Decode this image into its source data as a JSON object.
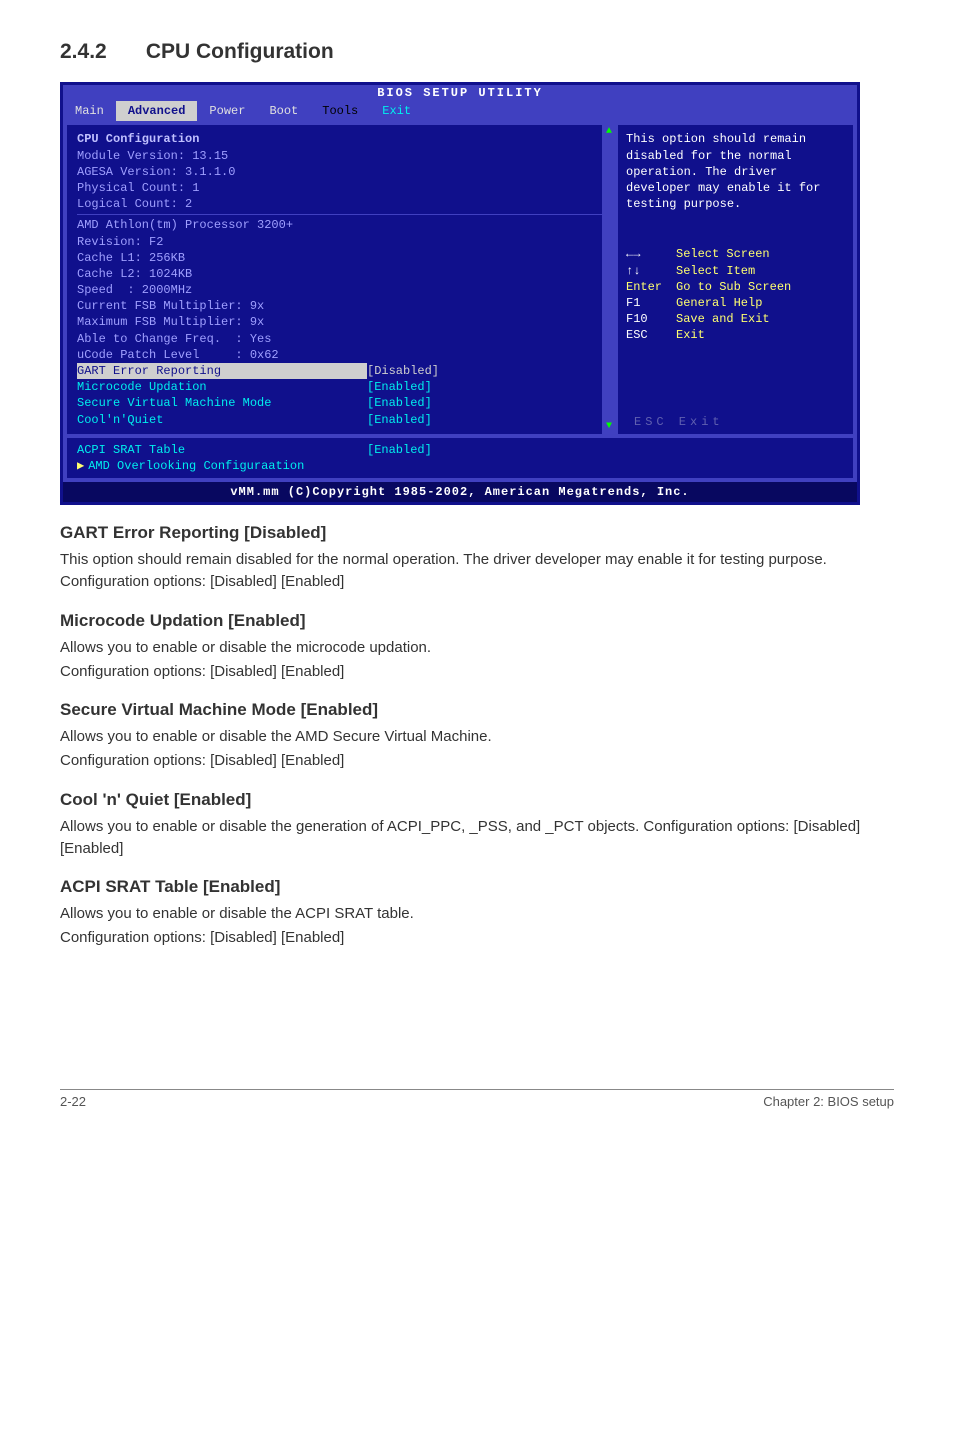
{
  "heading": {
    "number": "2.4.2",
    "title": "CPU Configuration"
  },
  "bios": {
    "util_title": "BIOS SETUP UTILITY",
    "tabs": {
      "main": "Main",
      "advanced": "Advanced",
      "power": "Power",
      "boot": "Boot",
      "tools": "Tools",
      "exit": "Exit"
    },
    "left": {
      "header": "CPU Configuration",
      "info": [
        "Module Version: 13.15",
        "AGESA Version: 3.1.1.0",
        "Physical Count: 1",
        "Logical Count: 2",
        "",
        "AMD Athlon(tm) Processor 3200+",
        "Revision: F2",
        "Cache L1: 256KB",
        "Cache L2: 1024KB",
        "Speed  : 2000MHz",
        "Current FSB Multiplier: 9x",
        "Maximum FSB Multiplier: 9x",
        "Able to Change Freq.  : Yes",
        "uCode Patch Level     : 0x62"
      ],
      "fields": {
        "gart": {
          "label": "GART Error Reporting",
          "value": "[Disabled]"
        },
        "micro": {
          "label": "Microcode Updation",
          "value": "[Enabled]"
        },
        "svm": {
          "label": "Secure Virtual Machine Mode",
          "value": "[Enabled]"
        },
        "cool": {
          "label": "Cool'n'Quiet",
          "value": "[Enabled]"
        }
      }
    },
    "right": {
      "help": "This option should remain disabled for the normal operation. The driver developer may enable it for testing purpose.",
      "legend": {
        "lr": {
          "k": "←→",
          "d": "Select Screen"
        },
        "ud": {
          "k": "↑↓",
          "d": "Select Item"
        },
        "ent": {
          "k": "Enter",
          "d": "Go to Sub Screen"
        },
        "f1": {
          "k": "F1",
          "d": "General Help"
        },
        "f10": {
          "k": "F10",
          "d": "Save and Exit"
        },
        "esc": {
          "k": "ESC",
          "d": "Exit"
        }
      },
      "ghost": "ESC   Exit"
    },
    "second": {
      "srat": {
        "label": "ACPI SRAT Table",
        "value": "[Enabled]"
      },
      "amd": {
        "label": "AMD Overlooking Configuraation"
      }
    },
    "footer": "vMM.mm (C)Copyright 1985-2002, American Megatrends, Inc."
  },
  "sections": {
    "gart": {
      "title": "GART Error Reporting [Disabled]",
      "p1": "This option should remain disabled for the normal operation. The driver developer may enable it for testing purpose. Configuration options: [Disabled] [Enabled]"
    },
    "micro": {
      "title": "Microcode Updation [Enabled]",
      "p1": "Allows you to enable or disable the microcode updation.",
      "p2": "Configuration options: [Disabled] [Enabled]"
    },
    "svm": {
      "title": "Secure Virtual Machine Mode [Enabled]",
      "p1": "Allows you to enable or disable the AMD Secure Virtual Machine.",
      "p2": "Configuration options: [Disabled] [Enabled]"
    },
    "cool": {
      "title": "Cool 'n' Quiet [Enabled]",
      "p1": "Allows you to enable or disable the generation of ACPI_PPC, _PSS, and _PCT objects. Configuration options: [Disabled] [Enabled]"
    },
    "srat": {
      "title": "ACPI SRAT Table [Enabled]",
      "p1": "Allows you to enable or disable the ACPI SRAT table.",
      "p2": "Configuration options: [Disabled] [Enabled]"
    }
  },
  "footer": {
    "left": "2-22",
    "right": "Chapter 2: BIOS setup"
  }
}
